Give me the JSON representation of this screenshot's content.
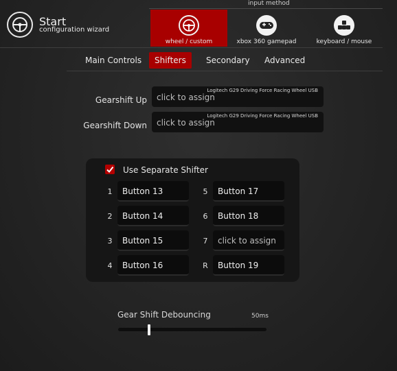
{
  "header": {
    "title": "Start",
    "subtitle": "configuration wizard",
    "logo_icon": "steering-wheel-icon"
  },
  "input_method": {
    "label": "input method",
    "options": [
      {
        "label": "wheel / custom",
        "icon": "steering-wheel-icon",
        "selected": true
      },
      {
        "label": "xbox 360 gamepad",
        "icon": "gamepad-icon",
        "selected": false
      },
      {
        "label": "keyboard / mouse",
        "icon": "keyboard-icon",
        "selected": false
      }
    ]
  },
  "tabs": [
    {
      "label": "Main Controls",
      "active": false
    },
    {
      "label": "Shifters",
      "active": true
    },
    {
      "label": "Secondary",
      "active": false
    },
    {
      "label": "Advanced",
      "active": false
    }
  ],
  "assignments": [
    {
      "label": "Gearshift Up",
      "device": "Logitech G29 Driving Force Racing Wheel USB",
      "value": "click to assign"
    },
    {
      "label": "Gearshift Down",
      "device": "Logitech G29 Driving Force Racing Wheel USB",
      "value": "click to assign"
    }
  ],
  "shifter": {
    "checkbox_label": "Use Separate Shifter",
    "checked": true,
    "gears": [
      {
        "num": "1",
        "value": "Button 13"
      },
      {
        "num": "2",
        "value": "Button 14"
      },
      {
        "num": "3",
        "value": "Button 15"
      },
      {
        "num": "4",
        "value": "Button 16"
      },
      {
        "num": "5",
        "value": "Button 17"
      },
      {
        "num": "6",
        "value": "Button 18"
      },
      {
        "num": "7",
        "value": "click to assign"
      },
      {
        "num": "R",
        "value": "Button 19"
      }
    ]
  },
  "debounce": {
    "label": "Gear Shift Debouncing",
    "value_text": "50ms",
    "fraction": 0.21
  },
  "colors": {
    "accent": "#a80000",
    "background": "#262626",
    "field": "#111111"
  }
}
